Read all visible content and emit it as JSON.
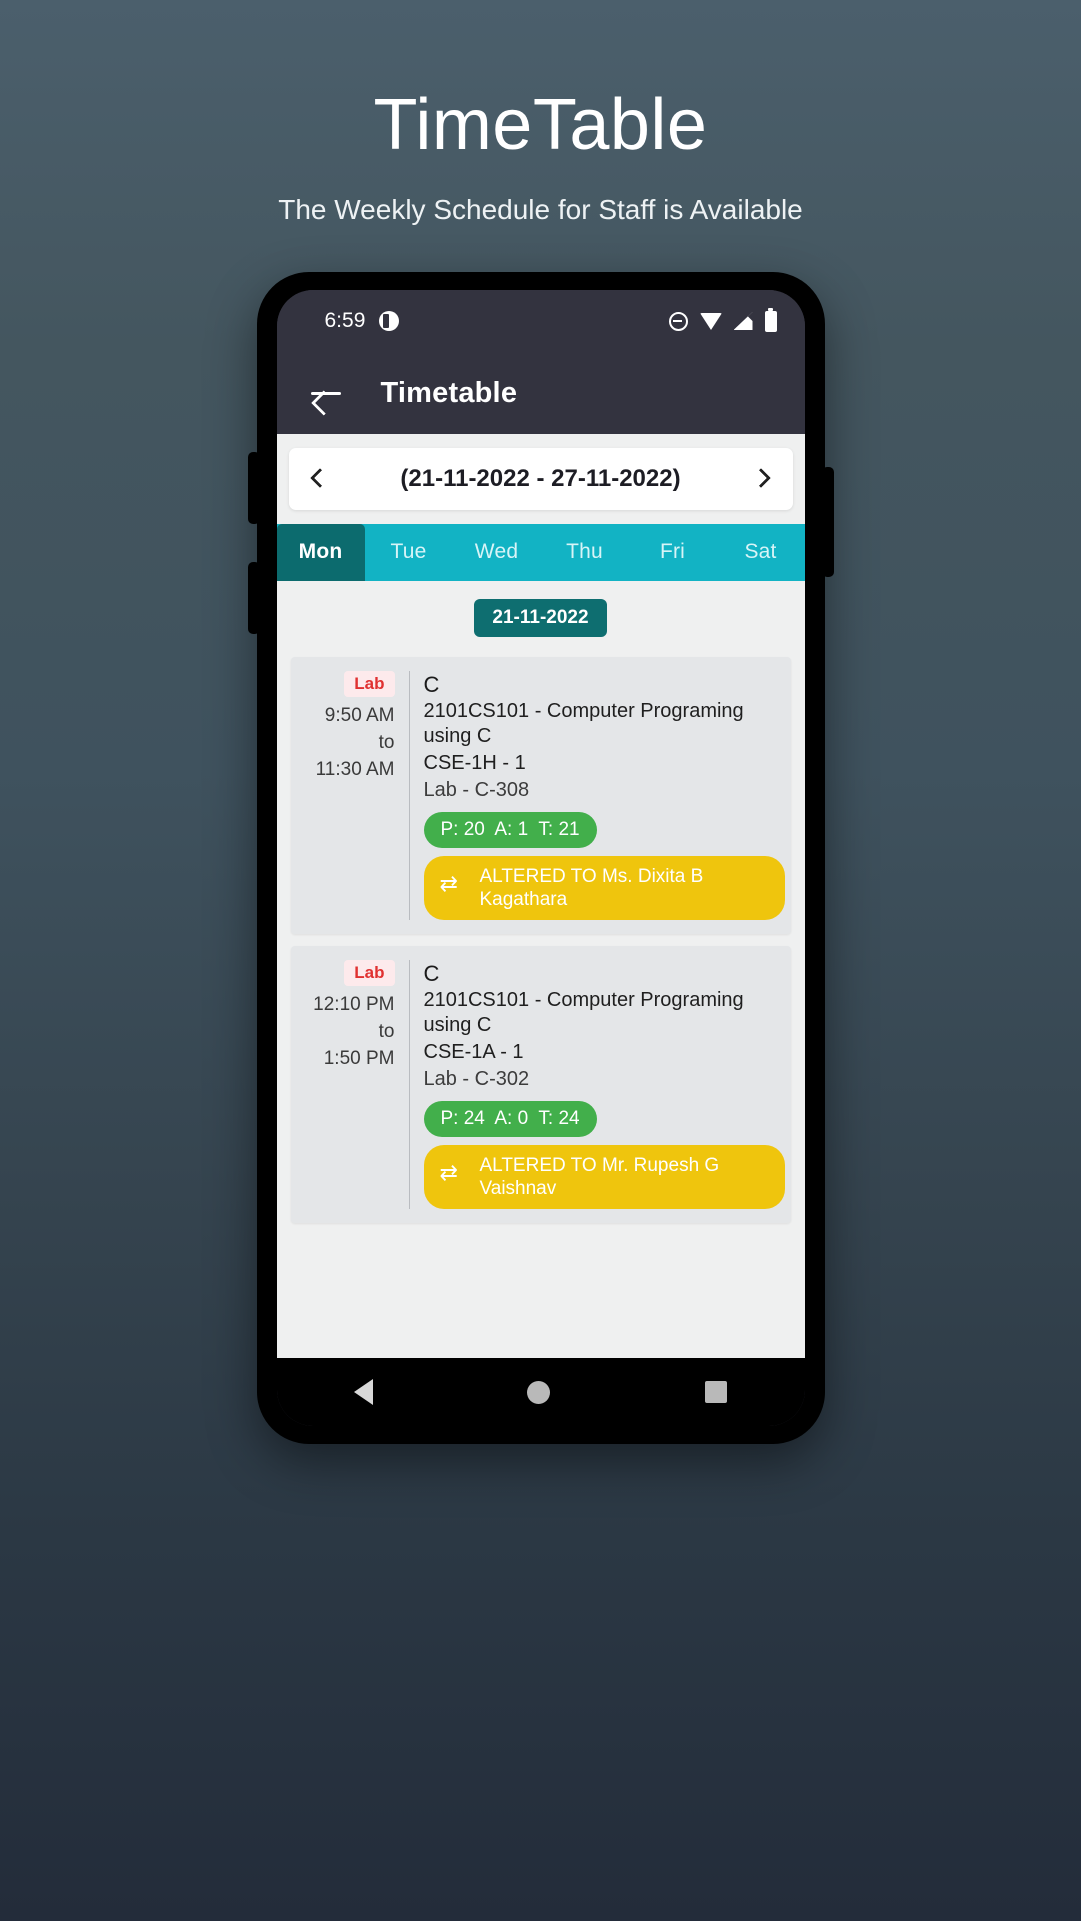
{
  "hero": {
    "title": "TimeTable",
    "subtitle": "The Weekly Schedule for Staff is Available"
  },
  "status_bar": {
    "time": "6:59",
    "icons": [
      "app-icon",
      "dnd-icon",
      "wifi-icon",
      "signal-icon",
      "battery-icon"
    ]
  },
  "app_bar": {
    "back_icon": "back-arrow-icon",
    "title": "Timetable"
  },
  "week_nav": {
    "prev_icon": "chevron-left-icon",
    "label": "(21-11-2022 - 27-11-2022)",
    "next_icon": "chevron-right-icon"
  },
  "day_tabs": [
    {
      "label": "Mon",
      "active": true
    },
    {
      "label": "Tue",
      "active": false
    },
    {
      "label": "Wed",
      "active": false
    },
    {
      "label": "Thu",
      "active": false
    },
    {
      "label": "Fri",
      "active": false
    },
    {
      "label": "Sat",
      "active": false
    }
  ],
  "selected_date": "21-11-2022",
  "classes": [
    {
      "type_badge": "Lab",
      "start_time": "9:50 AM",
      "separator": "to",
      "end_time": "11:30 AM",
      "subject_short": "C",
      "subject_full": "2101CS101 - Computer Programing using C",
      "batch": "CSE-1H - 1",
      "room": "Lab - C-308",
      "attendance": "P: 20  A: 1  T: 21",
      "altered_icon": "swap-icon",
      "altered_text": "ALTERED TO Ms. Dixita B Kagathara"
    },
    {
      "type_badge": "Lab",
      "start_time": "12:10 PM",
      "separator": "to",
      "end_time": "1:50 PM",
      "subject_short": "C",
      "subject_full": "2101CS101 - Computer Programing using C",
      "batch": "CSE-1A - 1",
      "room": "Lab - C-302",
      "attendance": "P: 24  A: 0  T: 24",
      "altered_icon": "swap-icon",
      "altered_text": "ALTERED TO Mr. Rupesh G Vaishnav"
    }
  ],
  "nav_bar": {
    "back": "nav-back-icon",
    "home": "nav-home-icon",
    "recents": "nav-recents-icon"
  },
  "colors": {
    "accent_teal": "#12b3c4",
    "active_tab": "#0c6b6e",
    "attendance_green": "#42af4b",
    "altered_yellow": "#efc50d",
    "lab_red": "#e03131",
    "appbar_dark": "#33333f"
  }
}
